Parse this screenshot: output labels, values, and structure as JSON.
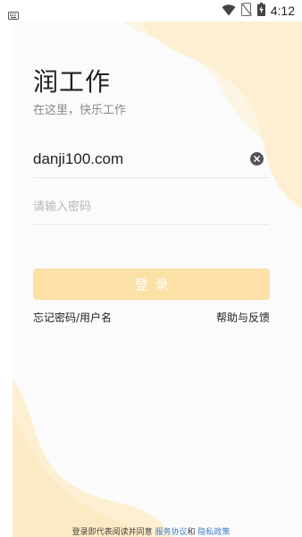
{
  "status_bar": {
    "time": "4:12",
    "icons": [
      "keyboard-icon",
      "wifi-icon",
      "no-sim-icon",
      "battery-charging-icon"
    ]
  },
  "login": {
    "title": "润工作",
    "subtitle": "在这里，快乐工作",
    "username_value": "danji100.com",
    "password_placeholder": "请输入密码",
    "login_button": "登录",
    "forgot_link": "忘记密码/用户名",
    "help_link": "帮助与反馈"
  },
  "agreement": {
    "prefix": "登录即代表阅读并同意 ",
    "service_link": "服务协议",
    "and": "和",
    "privacy_link": "隐私政策"
  },
  "colors": {
    "accent_light": "#fbe1a6",
    "blob_yellow": "#fdf0d2",
    "link_blue": "#3c7ecb"
  }
}
